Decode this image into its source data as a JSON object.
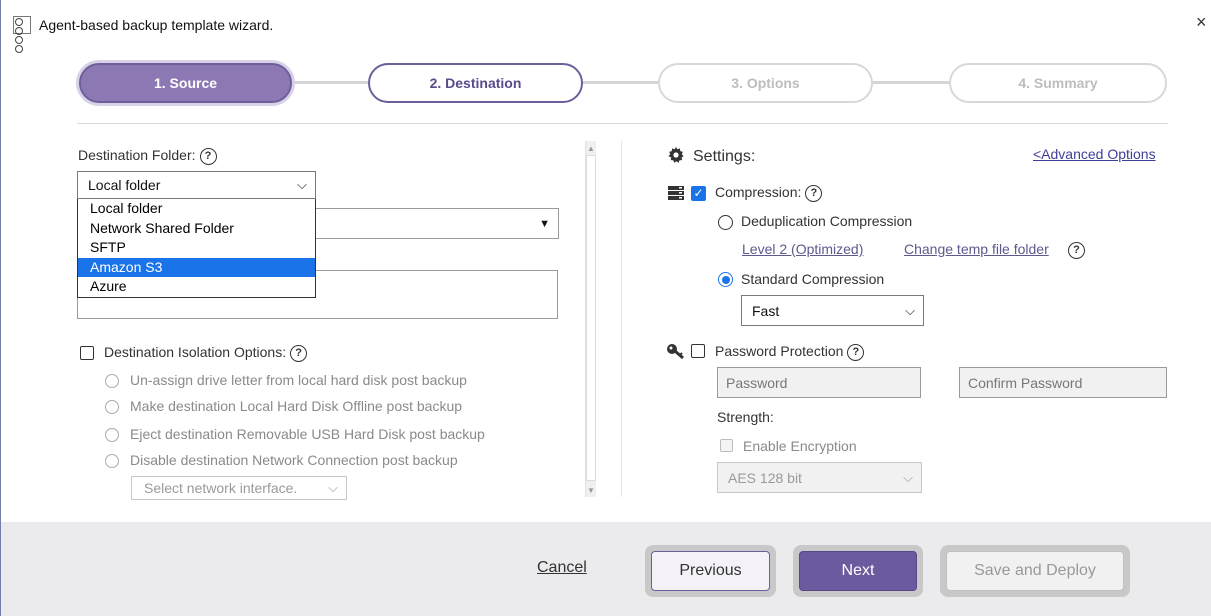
{
  "window": {
    "title": "Agent-based backup template wizard.",
    "close": "×"
  },
  "steps": [
    "1. Source",
    "2. Destination",
    "3. Options",
    "4. Summary"
  ],
  "left": {
    "destination_folder_label": "Destination Folder:",
    "destination_select_value": "Local folder",
    "dropdown_options": [
      "Local folder",
      "Network Shared Folder",
      "SFTP",
      "Amazon S3",
      "Azure"
    ],
    "dropdown_selected_index": 3,
    "isolation_label": "Destination Isolation Options:",
    "isolation_options": [
      "Un-assign drive letter from local hard disk post backup",
      "Make destination Local Hard Disk Offline post backup",
      "Eject destination Removable USB Hard Disk post backup",
      "Disable destination Network Connection post backup"
    ],
    "network_interface_placeholder": "Select network interface."
  },
  "right": {
    "settings_label": "Settings:",
    "advanced_link": "<Advanced Options",
    "compression_label": "Compression:",
    "dedup_label": "Deduplication Compression",
    "dedup_level_link": "Level 2 (Optimized)",
    "temp_folder_link": "Change temp file folder",
    "standard_label": "Standard Compression",
    "speed_value": "Fast",
    "password_label": "Password Protection",
    "password_placeholder": "Password",
    "confirm_placeholder": "Confirm Password",
    "strength_label": "Strength:",
    "encryption_label": "Enable Encryption",
    "aes_value": "AES 128 bit"
  },
  "footer": {
    "cancel": "Cancel",
    "previous": "Previous",
    "next": "Next",
    "save_deploy": "Save and Deploy"
  },
  "colors": {
    "accent": "#8c79b4",
    "primary": "#6c5a9e",
    "checkbox_blue": "#1a73e8"
  }
}
